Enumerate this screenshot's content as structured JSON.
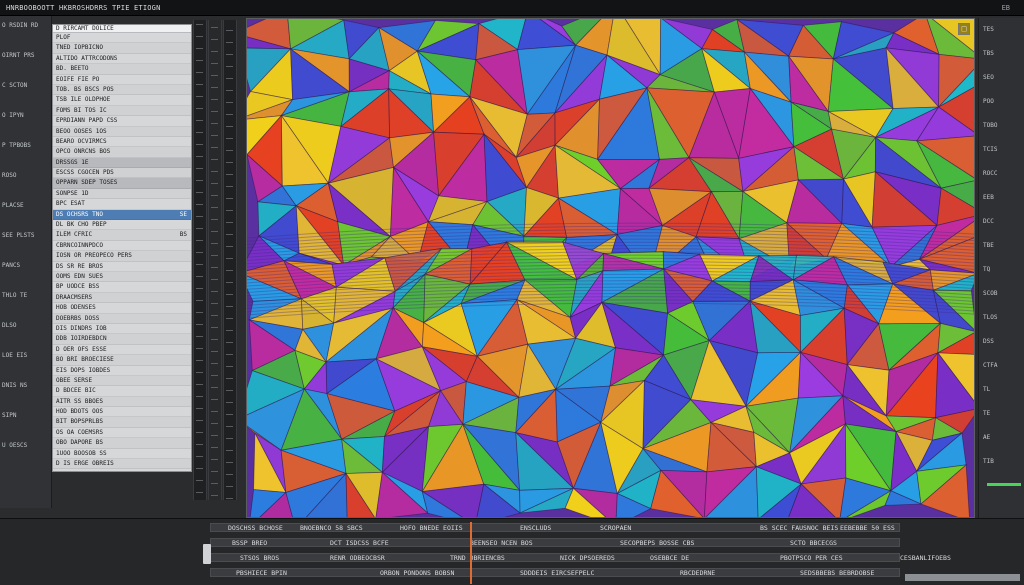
{
  "window": {
    "title": "HNRBOOBOOTT HKBROSHDRRS TPIE ETIOGN",
    "system_label": "EB"
  },
  "left_rail": {
    "items": [
      "O RSDIN RD",
      "OIRNT PRS",
      "C SCTON",
      "O IPYN",
      "P TPBOBS",
      "ROSO",
      "PLACSE",
      "SEE PLSTS",
      "PANCS",
      "THLO TE",
      "DLSO",
      "LOE EIS",
      "DNIS NS",
      "SIPN",
      "U OESCS"
    ]
  },
  "list_panel": {
    "header": "D RIRCAMT DOLICE",
    "rows": [
      {
        "label": "PLOF",
        "value": ""
      },
      {
        "label": "TNED IOPBICNO",
        "value": ""
      },
      {
        "label": "ALTIDO ATTRCODONS",
        "value": ""
      },
      {
        "label": "BD. BEETO",
        "value": ""
      },
      {
        "label": "EOIFE FIE PO",
        "value": ""
      },
      {
        "label": "TOB. BS BSCS POS",
        "value": ""
      },
      {
        "label": "TSB ILE OLDPHOE",
        "value": ""
      },
      {
        "label": "FOMS BI TOS IC",
        "value": ""
      },
      {
        "label": "EPRDIANN PAPD CSS",
        "value": ""
      },
      {
        "label": "BEOO OOSES 1OS",
        "value": ""
      },
      {
        "label": "BEARO OCVIRMCS",
        "value": ""
      },
      {
        "label": "OPCO ONRCNS BOS",
        "value": ""
      },
      {
        "label": "DRSSGS 1E",
        "value": ""
      },
      {
        "label": "ESCSS CGOCEN PDS",
        "value": ""
      },
      {
        "label": "OPPARN SDEP TOSES",
        "value": ""
      },
      {
        "label": "SONPSE 1D",
        "value": ""
      },
      {
        "label": "BPC ESAT",
        "value": ""
      },
      {
        "label": "DS OCHSRS TNO",
        "value": "SE"
      },
      {
        "label": "DL BK CHO PBEP",
        "value": ""
      },
      {
        "label": "ILEM CFRIC",
        "value": "BS"
      },
      {
        "label": "CBRNCOINNPDCO",
        "value": ""
      },
      {
        "label": "IOSN OR PREOPECO PERS",
        "value": ""
      },
      {
        "label": "DS SR RE BROS",
        "value": ""
      },
      {
        "label": "OOMS EDN SUES",
        "value": ""
      },
      {
        "label": "BP UODCE BSS",
        "value": ""
      },
      {
        "label": "DRAACMSERS",
        "value": ""
      },
      {
        "label": "HOB ODENSES",
        "value": ""
      },
      {
        "label": "DOEBRBS DOSS",
        "value": ""
      },
      {
        "label": "DIS DINDRS IOB",
        "value": ""
      },
      {
        "label": "DDB IOIRDEBDCN",
        "value": ""
      },
      {
        "label": "D OER OFS ESSE",
        "value": ""
      },
      {
        "label": "BO BRI BROECIESE",
        "value": ""
      },
      {
        "label": "EIS DOPS IOBDES",
        "value": ""
      },
      {
        "label": "OBEE SERSE",
        "value": ""
      },
      {
        "label": "D BDCEE BIC",
        "value": ""
      },
      {
        "label": "AITR SS BBOES",
        "value": ""
      },
      {
        "label": "HOD BDOTS OOS",
        "value": ""
      },
      {
        "label": "BIT BOPSPRLBS",
        "value": ""
      },
      {
        "label": "OS OA COEMSRS",
        "value": ""
      },
      {
        "label": "OBO DAPORE BS",
        "value": ""
      },
      {
        "label": "1UOO BOOSOB SS",
        "value": ""
      },
      {
        "label": "D IS ERGE OBREIS",
        "value": ""
      }
    ]
  },
  "right_panel": {
    "items": [
      "TES",
      "TBS",
      "SEO",
      "POO",
      "TOBO",
      "TCIS",
      "ROCC",
      "EEB",
      "DCC",
      "TBE",
      "TQ",
      "SCOB",
      "TLOS",
      "DSS",
      "CTFA",
      "TL",
      "TE",
      "AE",
      "TIB"
    ]
  },
  "timeline": {
    "row1": [
      "DOSCHSS BCHOSE",
      "BNOEBNCO 58 SBCS",
      "HOFO BNEDE EOIIS",
      "ENSCLUDS",
      "SCROPAEN",
      "BS SCEC FAUSNOC BEIS",
      "EEBEBBE 50 ESS"
    ],
    "row2": [
      "BSSP BREO",
      "DCT ISDCSS BCFE",
      "BEENSEO NCEN BOS",
      "SECOPBEPS BOSSE CBS",
      "SCTO BBCECGS"
    ],
    "row3": [
      "STSOS BROS",
      "RENR ODBEOCBSR",
      "TRND DBRIENCBS",
      "NICK DPSOEREDS",
      "OSEBBCE DE",
      "PBOTPSCO PER CES",
      "CESBANLIFOEBS"
    ],
    "row4": [
      "PBSHIECE BPIN",
      "ORBON PONDONS BOBSN",
      "SDDDEIS EIRCSEFPELC",
      "RBCDEDRNE",
      "SEDSBBEBS BEBRDOBSE"
    ]
  },
  "canvas": {
    "corner_button": "□"
  },
  "colors": {
    "accent": "#4e7db3",
    "marker": "#e06c34",
    "level": "#48d45a"
  }
}
